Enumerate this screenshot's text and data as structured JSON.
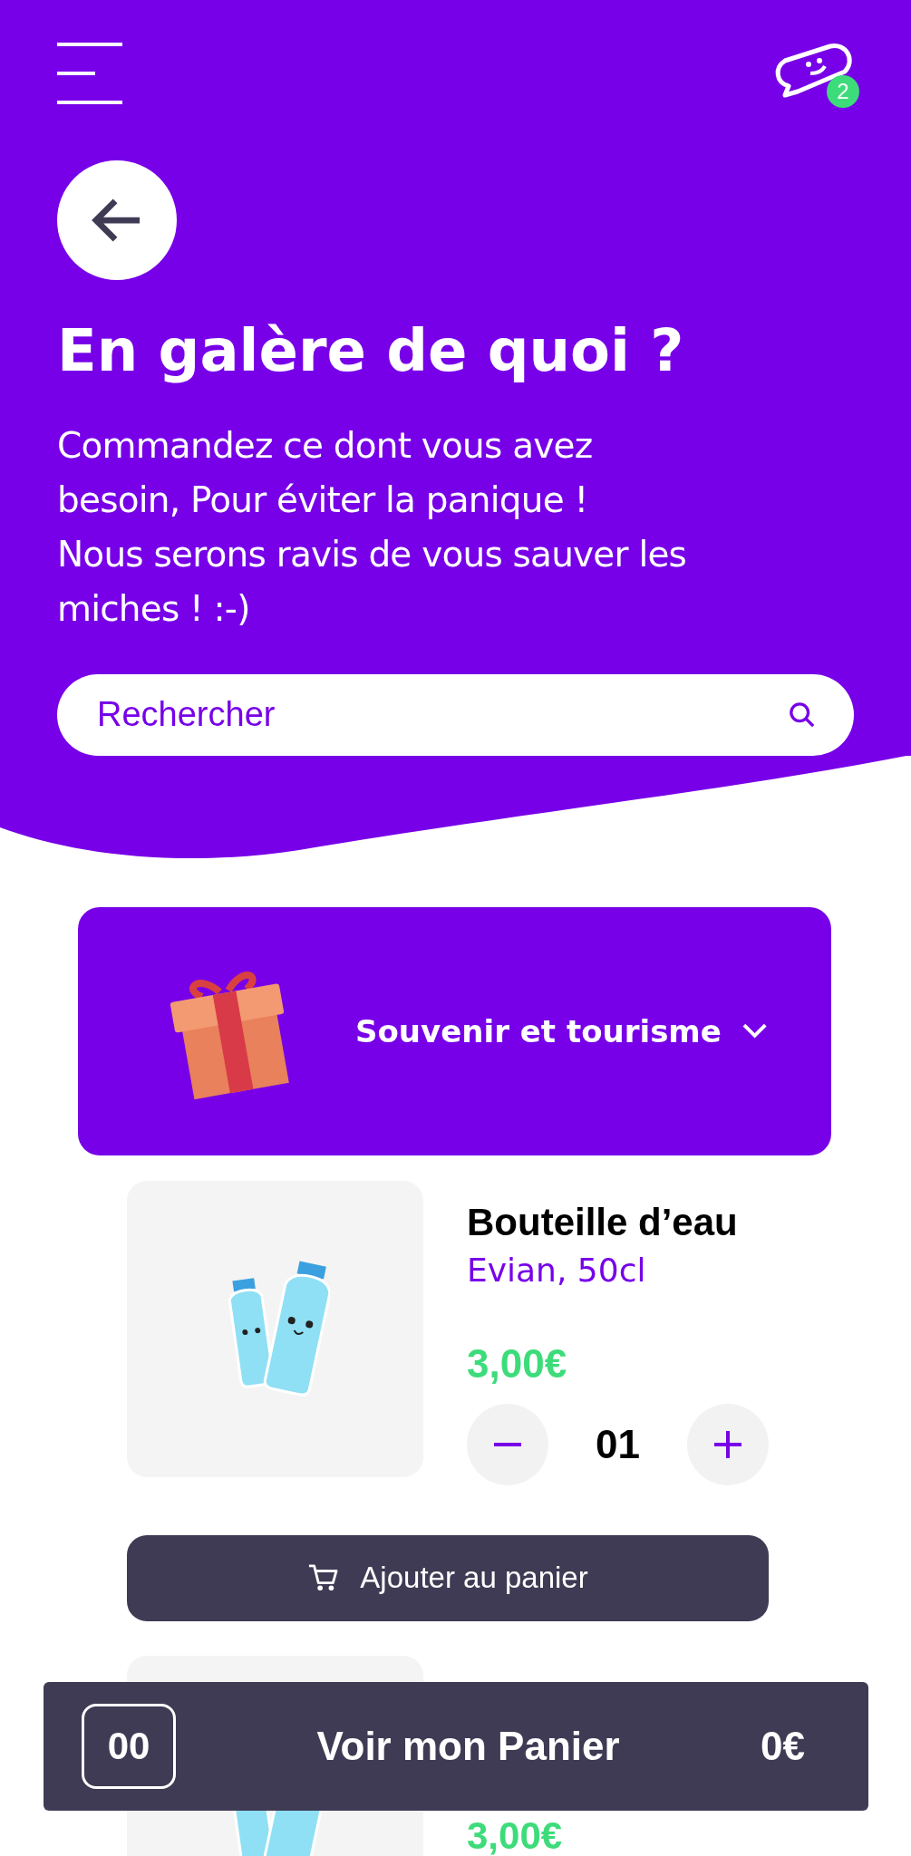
{
  "header": {
    "notification_count": "2",
    "title": "En galère de quoi ?",
    "intro": "Commandez ce dont vous avez\nbesoin, Pour éviter la panique !\nNous serons ravis de vous sauver les\nmiches ! :-)"
  },
  "search": {
    "placeholder": "Rechercher"
  },
  "category": {
    "label": "Souvenir et tourisme",
    "expanded": false
  },
  "products": [
    {
      "name": "Bouteille d’eau",
      "detail": "Evian, 50cl",
      "price": "3,00€",
      "quantity": "01",
      "add_label": "Ajouter au panier"
    },
    {
      "price": "3,00€"
    }
  ],
  "cart_bar": {
    "count": "00",
    "label": "Voir mon Panier",
    "total": "0€"
  }
}
